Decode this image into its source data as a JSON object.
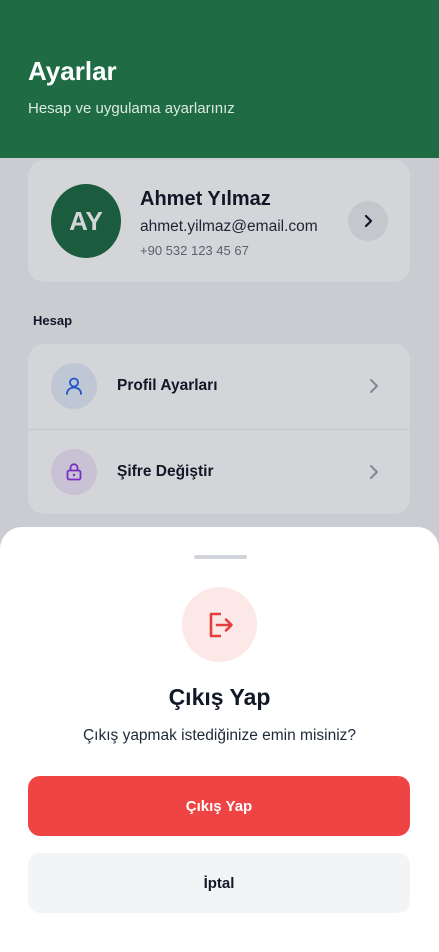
{
  "header": {
    "title": "Ayarlar",
    "subtitle": "Hesap ve uygulama ayarlarınız"
  },
  "profile": {
    "initials": "AY",
    "name": "Ahmet Yılmaz",
    "email": "ahmet.yilmaz@email.com",
    "phone": "+90 532 123 45 67"
  },
  "account_section": {
    "label": "Hesap",
    "items": [
      {
        "label": "Profil Ayarları",
        "icon": "user-icon",
        "icon_color": "#2563eb",
        "icon_bg": "#e6edfb"
      },
      {
        "label": "Şifre Değiştir",
        "icon": "lock-icon",
        "icon_color": "#9333ea",
        "icon_bg": "#f1e8fb"
      }
    ]
  },
  "logout_dialog": {
    "icon": "logout-icon",
    "title": "Çıkış Yap",
    "message": "Çıkış yapmak istediğinize emin misiniz?",
    "confirm_label": "Çıkış Yap",
    "cancel_label": "İptal"
  },
  "colors": {
    "brand": "#1e6b44",
    "danger": "#ef4444"
  }
}
